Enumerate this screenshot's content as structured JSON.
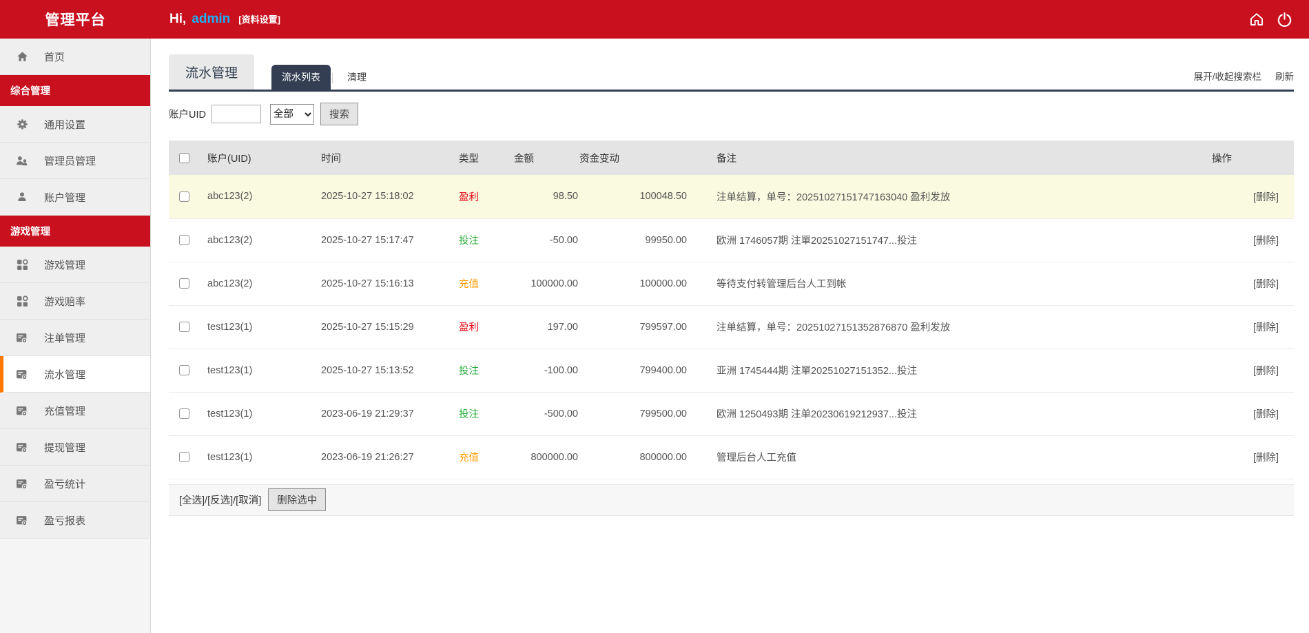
{
  "header": {
    "brand": "管理平台",
    "greeting_prefix": "Hi,",
    "username": "admin",
    "profile_link": "[资料设置]"
  },
  "colors": {
    "bar_red": "#c8101e",
    "tab_navy": "#333e52",
    "active_orange": "#ff7800",
    "row_highlight": "#fafae1",
    "types": {
      "盈利": "#e60012",
      "投注": "#23ac38",
      "充值": "#ff9900"
    }
  },
  "sidebar": {
    "items": [
      {
        "type": "item",
        "label": "首页",
        "icon": "home-icon"
      },
      {
        "type": "section",
        "label": "综合管理"
      },
      {
        "type": "item",
        "label": "通用设置",
        "icon": "gear-icon"
      },
      {
        "type": "item",
        "label": "管理员管理",
        "icon": "admins-icon"
      },
      {
        "type": "item",
        "label": "账户管理",
        "icon": "user-icon"
      },
      {
        "type": "section",
        "label": "游戏管理"
      },
      {
        "type": "item",
        "label": "游戏管理",
        "icon": "grid-icon"
      },
      {
        "type": "item",
        "label": "游戏赔率",
        "icon": "grid-icon"
      },
      {
        "type": "item",
        "label": "注单管理",
        "icon": "doc-icon"
      },
      {
        "type": "item",
        "label": "流水管理",
        "icon": "doc-icon",
        "active": true
      },
      {
        "type": "item",
        "label": "充值管理",
        "icon": "doc-icon"
      },
      {
        "type": "item",
        "label": "提现管理",
        "icon": "doc-icon"
      },
      {
        "type": "item",
        "label": "盈亏统计",
        "icon": "doc-icon"
      },
      {
        "type": "item",
        "label": "盈亏报表",
        "icon": "doc-icon"
      }
    ]
  },
  "main": {
    "page_title": "流水管理",
    "tabs": [
      {
        "label": "流水列表",
        "active": true
      },
      {
        "label": "清理",
        "active": false
      }
    ],
    "toolbar": {
      "toggle_search": "展开/收起搜索栏",
      "refresh": "刷新"
    },
    "search": {
      "uid_label": "账户UID",
      "uid_value": "",
      "type_selected": "全部",
      "search_button": "搜索"
    },
    "table": {
      "columns": [
        "账户(UID)",
        "时间",
        "类型",
        "金额",
        "资金变动",
        "备注",
        "操作"
      ],
      "action_label": "[删除]",
      "rows": [
        {
          "uid": "abc123(2)",
          "time": "2025-10-27 15:18:02",
          "type": "盈利",
          "amount": "98.50",
          "balance": "100048.50",
          "note": "注单结算，单号：20251027151747163040 盈利发放",
          "highlight": true
        },
        {
          "uid": "abc123(2)",
          "time": "2025-10-27 15:17:47",
          "type": "投注",
          "amount": "-50.00",
          "balance": "99950.00",
          "note": "欧洲 1746057期 注單20251027151747...投注"
        },
        {
          "uid": "abc123(2)",
          "time": "2025-10-27 15:16:13",
          "type": "充值",
          "amount": "100000.00",
          "balance": "100000.00",
          "note": "等待支付转管理后台人工到帐"
        },
        {
          "uid": "test123(1)",
          "time": "2025-10-27 15:15:29",
          "type": "盈利",
          "amount": "197.00",
          "balance": "799597.00",
          "note": "注单结算，单号：20251027151352876870 盈利发放"
        },
        {
          "uid": "test123(1)",
          "time": "2025-10-27 15:13:52",
          "type": "投注",
          "amount": "-100.00",
          "balance": "799400.00",
          "note": "亚洲 1745444期 注單20251027151352...投注"
        },
        {
          "uid": "test123(1)",
          "time": "2023-06-19 21:29:37",
          "type": "投注",
          "amount": "-500.00",
          "balance": "799500.00",
          "note": "欧洲 1250493期 注单20230619212937...投注"
        },
        {
          "uid": "test123(1)",
          "time": "2023-06-19 21:26:27",
          "type": "充值",
          "amount": "800000.00",
          "balance": "800000.00",
          "note": "管理后台人工充值"
        }
      ]
    },
    "footer": {
      "select_links": "[全选]/[反选]/[取消]",
      "delete_button": "删除选中"
    }
  }
}
